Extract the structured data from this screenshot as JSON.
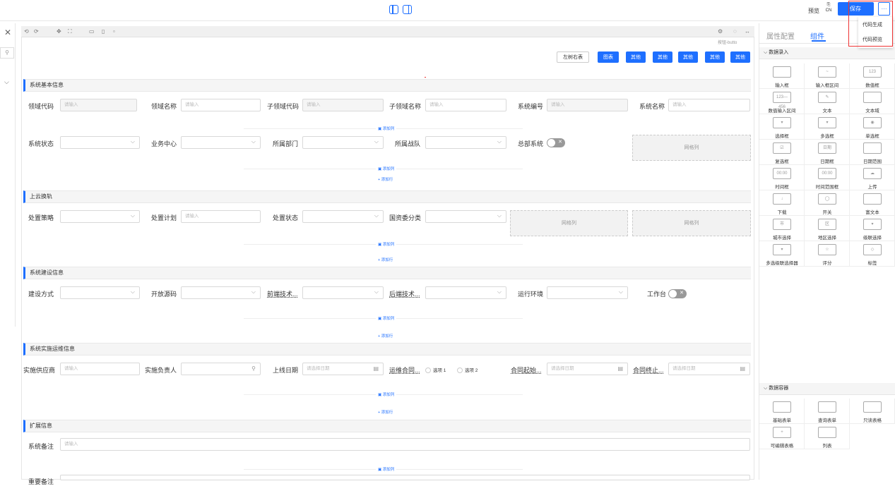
{
  "topbar": {
    "preview_label": "预览",
    "lang_label": "CN",
    "save_label": "保存",
    "more_label": "···"
  },
  "menu": {
    "items": [
      "代码生成",
      "代码预览"
    ]
  },
  "canvas": {
    "hint": "按钮-butto",
    "toolbar_buttons": [
      "左树右表",
      "图表",
      "其他",
      "其他",
      "其他",
      "其他",
      "其他"
    ]
  },
  "sections": {
    "basic": {
      "title": "系统基本信息",
      "fields": {
        "domain_code": "领域代码",
        "domain_name": "领域名称",
        "subdomain_code": "子领域代码",
        "subdomain_name": "子领域名称",
        "system_no": "系统编号",
        "system_name": "系统名称",
        "system_status": "系统状态",
        "business_center": "业务中心",
        "department": "所属部门",
        "team": "所属战队",
        "main_system": "总部系统"
      }
    },
    "cloud": {
      "title": "上云换轨",
      "fields": {
        "strategy": "处置策略",
        "plan": "处置计划",
        "state": "处置状态",
        "classify": "国资委分类"
      }
    },
    "build": {
      "title": "系统建设信息",
      "fields": {
        "method": "建设方式",
        "open_source": "开放源码",
        "frontend": "前端技术...",
        "backend": "后端技术...",
        "env": "运行环境",
        "workbench": "工作台"
      }
    },
    "ops": {
      "title": "系统实施运维信息",
      "fields": {
        "vendor": "实施供应商",
        "owner": "实施负责人",
        "online_date": "上线日期",
        "contract": "运维合同...",
        "contract_start": "合同起始...",
        "contract_end": "合同终止..."
      },
      "radio_options": [
        "选项 1",
        "选项 2"
      ]
    },
    "ext": {
      "title": "扩展信息",
      "fields": {
        "remark": "系统备注",
        "key_remark": "重要备注"
      }
    }
  },
  "placeholders": {
    "input": "请输入",
    "date": "请选择日期"
  },
  "grid_label": "网格列",
  "add_col": "添加列",
  "add_row": "+ 添加行",
  "rpanel": {
    "tabs": [
      "属性配置",
      "组件"
    ],
    "cat1": "数据录入",
    "tiles1": [
      "输入框",
      "输入框区间",
      "数值框",
      "数值输入区间",
      "文本",
      "文本域",
      "选择框",
      "多选框",
      "单选框",
      "复选框",
      "日期框",
      "日期范围",
      "时间框",
      "时间范围框",
      "上传",
      "下载",
      "开关",
      "富文本",
      "城市选择",
      "地区选择",
      "级联选择",
      "多选级联选择器",
      "评分",
      "标签"
    ],
    "cat2": "数据容器",
    "tiles2": [
      "基础表单",
      "查询表单",
      "只读表格",
      "可编辑表格",
      "列表"
    ],
    "glyphs": [
      "",
      "~",
      "123",
      "123—456",
      "✎",
      "",
      "▾",
      "▾",
      "◉",
      "☑",
      "日期",
      "",
      "00:00",
      "00:00",
      "☁",
      "↓",
      "◯",
      "",
      "市",
      "区",
      "▾",
      "▾",
      "☆",
      "◇",
      "",
      "",
      "",
      "+",
      ""
    ]
  }
}
